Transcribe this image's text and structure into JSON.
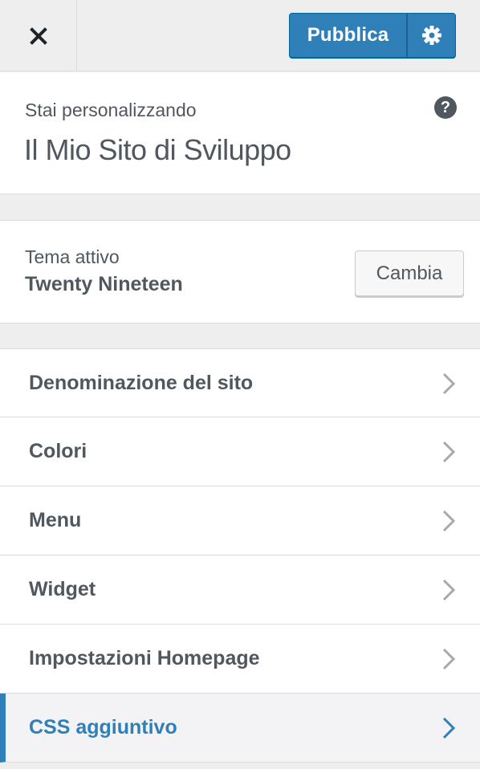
{
  "header": {
    "close_icon": "close-icon",
    "publish_label": "Pubblica",
    "settings_icon": "gear-icon",
    "accent_color": "#2f7fb8"
  },
  "info": {
    "label": "Stai personalizzando",
    "site_title": "Il Mio Sito di Sviluppo",
    "help_symbol": "?"
  },
  "theme": {
    "label": "Tema attivo",
    "name": "Twenty Nineteen",
    "change_label": "Cambia"
  },
  "menu": {
    "items": [
      {
        "label": "Denominazione del sito"
      },
      {
        "label": "Colori"
      },
      {
        "label": "Menu"
      },
      {
        "label": "Widget"
      },
      {
        "label": "Impostazioni Homepage"
      },
      {
        "label": "CSS aggiuntivo",
        "active": true
      }
    ]
  }
}
